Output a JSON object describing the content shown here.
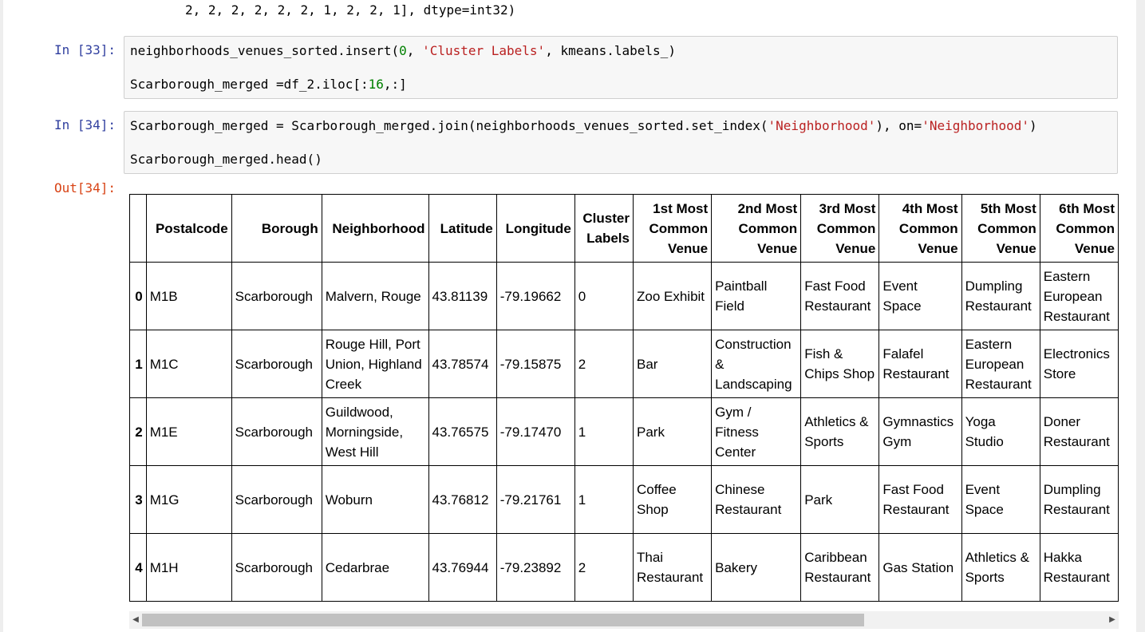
{
  "top_output": "2, 2, 2, 2, 2, 2, 1, 2, 2, 1], dtype=int32)",
  "cells": [
    {
      "prompt": "In [33]:",
      "lines": [
        [
          {
            "t": "neighborhoods_venues_sorted.insert(",
            "c": ""
          },
          {
            "t": "0",
            "c": "num"
          },
          {
            "t": ", ",
            "c": ""
          },
          {
            "t": "'Cluster Labels'",
            "c": "str"
          },
          {
            "t": ", kmeans.labels_)",
            "c": ""
          }
        ],
        [
          {
            "t": "Scarborough_merged =df_2.iloc[:",
            "c": ""
          },
          {
            "t": "16",
            "c": "num"
          },
          {
            "t": ",:]",
            "c": ""
          }
        ]
      ]
    },
    {
      "prompt": "In [34]:",
      "lines": [
        [
          {
            "t": "Scarborough_merged = Scarborough_merged.join(neighborhoods_venues_sorted.set_index(",
            "c": ""
          },
          {
            "t": "'Neighborhood'",
            "c": "str"
          },
          {
            "t": "), on=",
            "c": ""
          },
          {
            "t": "'Neighborhood'",
            "c": "str"
          },
          {
            "t": ")",
            "c": ""
          }
        ],
        [
          {
            "t": "Scarborough_merged.head()",
            "c": ""
          }
        ]
      ]
    }
  ],
  "out_prompt": "Out[34]:",
  "dataframe": {
    "columns": [
      "",
      "Postalcode",
      "Borough",
      "Neighborhood",
      "Latitude",
      "Longitude",
      "Cluster Labels",
      "1st Most Common Venue",
      "2nd Most Common Venue",
      "3rd Most Common Venue",
      "4th Most Common Venue",
      "5th Most Common Venue",
      "6th Most Common Venue"
    ],
    "rows": [
      [
        "0",
        "M1B",
        "Scarborough",
        "Malvern, Rouge",
        "43.81139",
        "-79.19662",
        "0",
        "Zoo Exhibit",
        "Paintball Field",
        "Fast Food Restaurant",
        "Event Space",
        "Dumpling Restaurant",
        "Eastern European Restaurant"
      ],
      [
        "1",
        "M1C",
        "Scarborough",
        "Rouge Hill, Port Union, Highland Creek",
        "43.78574",
        "-79.15875",
        "2",
        "Bar",
        "Construction & Landscaping",
        "Fish & Chips Shop",
        "Falafel Restaurant",
        "Eastern European Restaurant",
        "Electronics Store"
      ],
      [
        "2",
        "M1E",
        "Scarborough",
        "Guildwood, Morningside, West Hill",
        "43.76575",
        "-79.17470",
        "1",
        "Park",
        "Gym / Fitness Center",
        "Athletics & Sports",
        "Gymnastics Gym",
        "Yoga Studio",
        "Doner Restaurant"
      ],
      [
        "3",
        "M1G",
        "Scarborough",
        "Woburn",
        "43.76812",
        "-79.21761",
        "1",
        "Coffee Shop",
        "Chinese Restaurant",
        "Park",
        "Fast Food Restaurant",
        "Event Space",
        "Dumpling Restaurant"
      ],
      [
        "4",
        "M1H",
        "Scarborough",
        "Cedarbrae",
        "43.76944",
        "-79.23892",
        "2",
        "Thai Restaurant",
        "Bakery",
        "Caribbean Restaurant",
        "Gas Station",
        "Athletics & Sports",
        "Hakka Restaurant"
      ]
    ]
  },
  "scrollbar": {
    "left_arrow_icon": "triangle-left-icon",
    "right_arrow_icon": "triangle-right-icon",
    "position": 0.0
  }
}
